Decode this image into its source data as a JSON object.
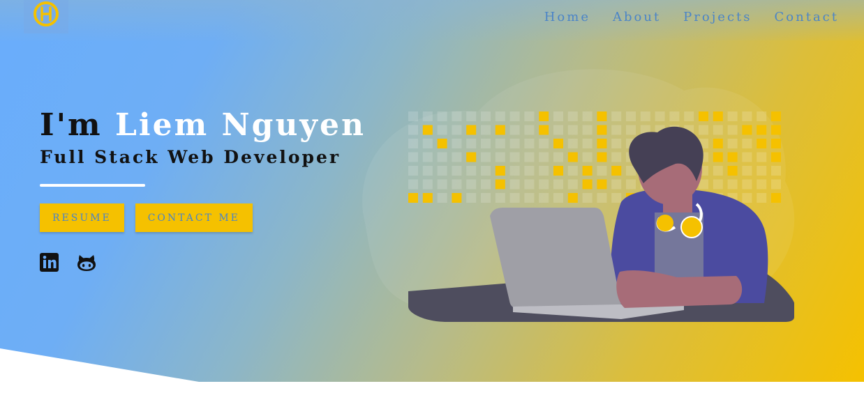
{
  "nav": {
    "items": [
      "Home",
      "About",
      "Projects",
      "Contact"
    ]
  },
  "hero": {
    "greeting": "I'm",
    "name": "Liem Nguyen",
    "role": "Full Stack Web Developer",
    "resume_label": "RESUME",
    "contact_label": "CONTACT ME"
  },
  "icons": {
    "logo": "logo-icon",
    "linkedin": "linkedin-icon",
    "github": "github-icon"
  },
  "colors": {
    "accent": "#f5c100",
    "link": "#4a84c8",
    "gradient_start": "#69adfc",
    "gradient_end": "#f5c100"
  }
}
